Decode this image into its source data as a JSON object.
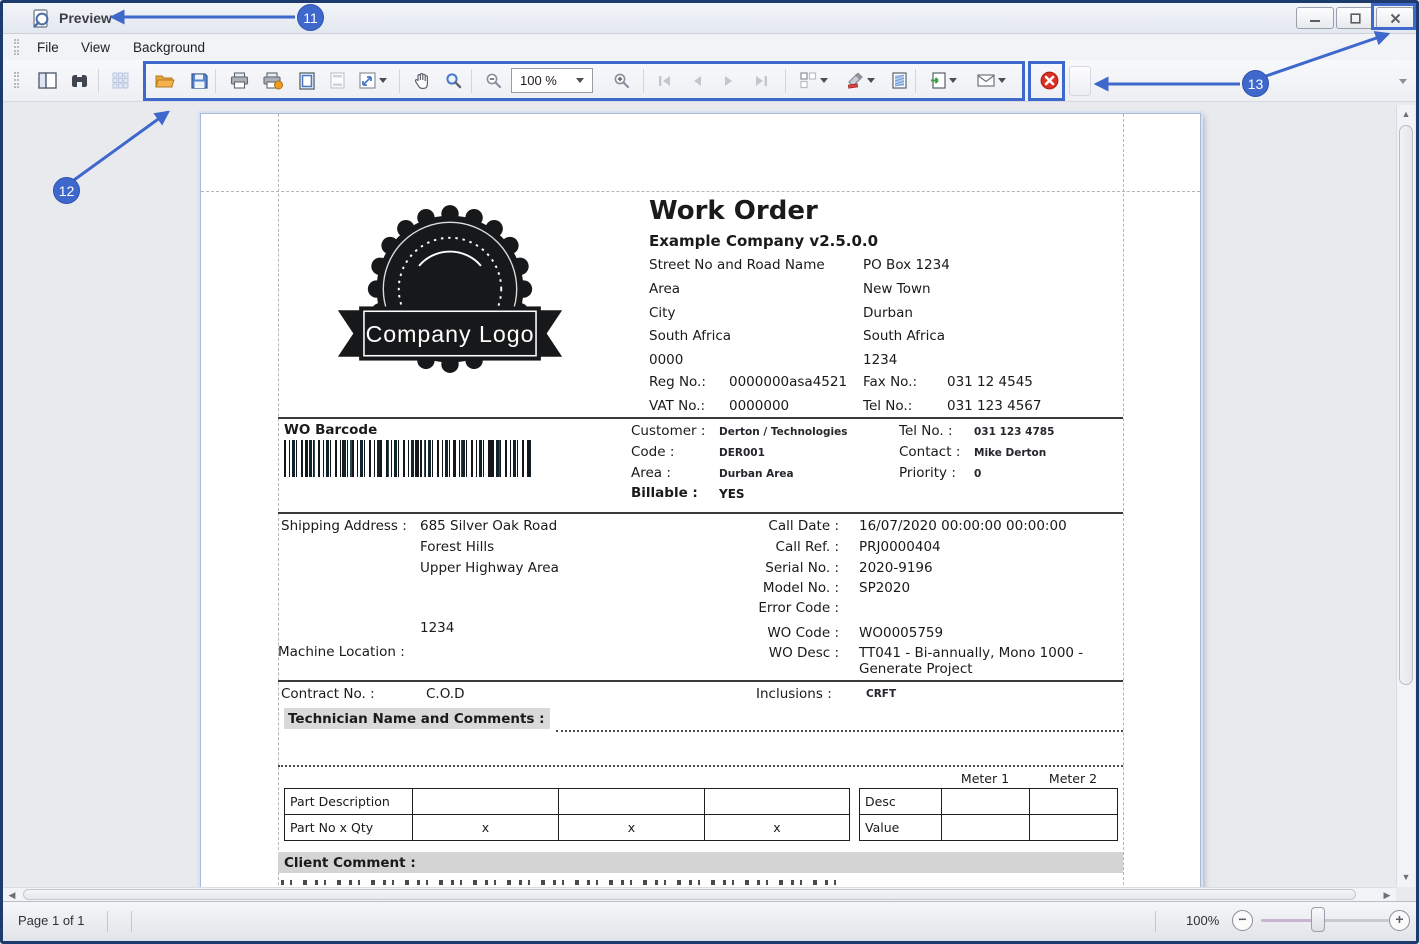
{
  "window": {
    "title": "Preview",
    "minimize": "–",
    "maximize": "❐",
    "close": "✕"
  },
  "menu": {
    "items": [
      "File",
      "View",
      "Background"
    ]
  },
  "toolbar": {
    "zoom_value": "100 %"
  },
  "statusbar": {
    "page_info": "Page 1 of 1",
    "zoom_label": "100%"
  },
  "annotations": {
    "n11": "11",
    "n12": "12",
    "n13": "13"
  },
  "document": {
    "title": "Work Order",
    "company": "Example Company v2.5.0.0",
    "logo_text": "Company Logo",
    "address_left": [
      "Street No and Road Name",
      "Area",
      "City",
      "South Africa",
      "0000"
    ],
    "address_right": [
      "PO Box 1234",
      "New Town",
      "Durban",
      "South Africa",
      "1234"
    ],
    "reg": {
      "label": "Reg No.:",
      "value": "0000000asa4521"
    },
    "vat": {
      "label": "VAT No.:",
      "value": "0000000"
    },
    "fax": {
      "label": "Fax No.:",
      "value": "031 12 4545"
    },
    "tel": {
      "label": "Tel No.:",
      "value": "031 123 4567"
    },
    "barcode_label": "WO Barcode",
    "customer": {
      "label": "Customer :",
      "value": "Derton / Technologies"
    },
    "code": {
      "label": "Code :",
      "value": "DER001"
    },
    "area": {
      "label": "Area :",
      "value": "Durban Area"
    },
    "billable": {
      "label": "Billable :",
      "value": "YES"
    },
    "tel2": {
      "label": "Tel No. :",
      "value": "031 123 4785"
    },
    "contact": {
      "label": "Contact :",
      "value": "Mike Derton"
    },
    "priority": {
      "label": "Priority :",
      "value": "0"
    },
    "shipping": {
      "label": "Shipping Address :",
      "line1": "685 Silver Oak Road",
      "line2": "Forest Hills",
      "line3": "Upper Highway Area",
      "code": "1234"
    },
    "machine_location_label": "Machine Location :",
    "call_date": {
      "label": "Call Date :",
      "value": "16/07/2020 00:00:00 00:00:00"
    },
    "call_ref": {
      "label": "Call Ref. :",
      "value": "PRJ0000404"
    },
    "serial": {
      "label": "Serial No. :",
      "value": "2020-9196"
    },
    "model": {
      "label": "Model No. :",
      "value": "SP2020"
    },
    "error_code": {
      "label": "Error Code :",
      "value": ""
    },
    "wo_code": {
      "label": "WO Code :",
      "value": "WO0005759"
    },
    "wo_desc": {
      "label": "WO Desc :",
      "value": "TT041 - Bi-annually, Mono 1000 -",
      "value2": "Generate Project"
    },
    "contract": {
      "label": "Contract No. :",
      "value": "C.O.D"
    },
    "inclusions": {
      "label": "Inclusions :",
      "value": "CRFT"
    },
    "technician_label": "Technician Name and Comments :",
    "meter1": "Meter 1",
    "meter2": "Meter 2",
    "parts_table": {
      "rows": [
        [
          "Part Description",
          "",
          "",
          ""
        ],
        [
          "Part No x Qty",
          "x",
          "x",
          "x"
        ]
      ]
    },
    "meter_table": {
      "rows": [
        [
          "Desc",
          "",
          ""
        ],
        [
          "Value",
          "",
          ""
        ]
      ]
    },
    "client_comment_label": "Client Comment :"
  }
}
